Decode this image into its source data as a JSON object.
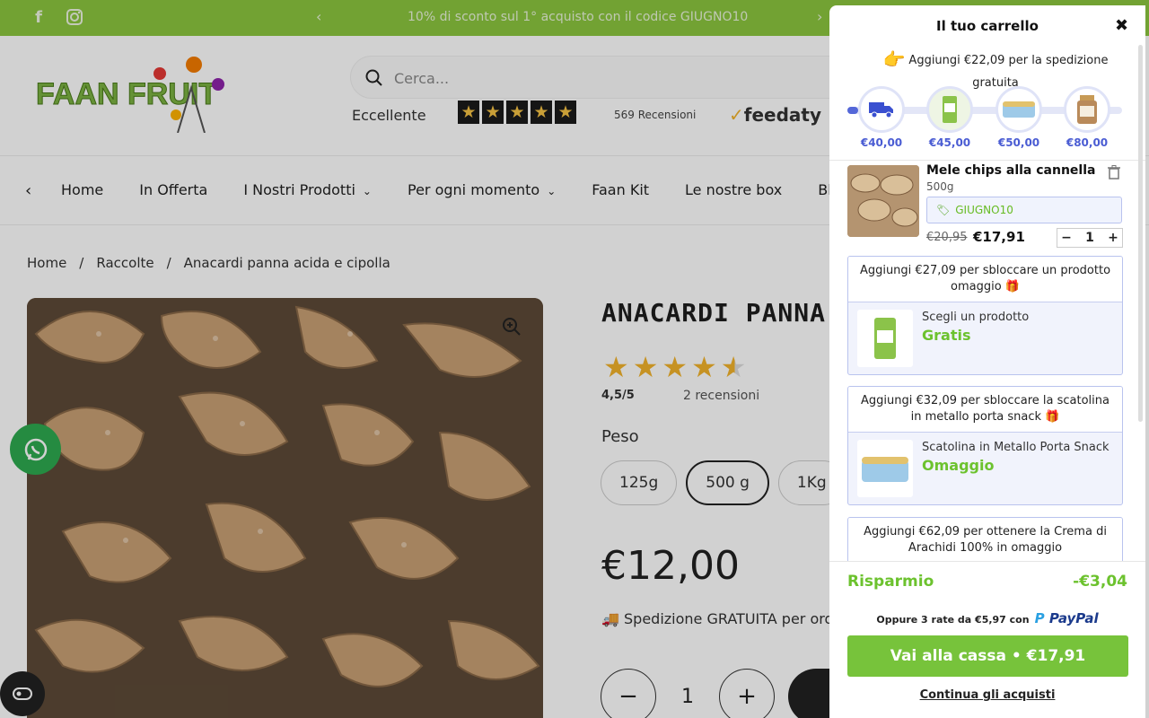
{
  "announcement": {
    "message": "10% di sconto sul 1° acquisto con il codice GIUGNO10",
    "prev": "‹",
    "next": "›",
    "social": [
      "facebook-icon",
      "instagram-icon"
    ]
  },
  "header": {
    "logo_text": "FAAN FRUIT",
    "search_placeholder": "Cerca...",
    "rating_label": "Eccellente",
    "reviews": "569 Recensioni",
    "review_brand": "feedaty"
  },
  "nav": {
    "items": [
      "Home",
      "In Offerta",
      "I Nostri Prodotti",
      "Per ogni momento",
      "Faan Kit",
      "Le nostre box",
      "Blog"
    ]
  },
  "breadcrumb": [
    "Home",
    "/",
    "Raccolte",
    "/",
    "Anacardi panna acida e cipolla"
  ],
  "product": {
    "title": "ANACARDI PANNA ACI",
    "rating": "4,5/5",
    "reviews": "2 recensioni",
    "weight_label": "Peso",
    "options": [
      "125g",
      "500 g",
      "1Kg"
    ],
    "selected_option": "500 g",
    "price": "€12,00",
    "shipping": "🚚 Spedizione GRATUITA per ord",
    "quantity": "1",
    "minus": "−",
    "plus": "+"
  },
  "cart": {
    "title": "Il tuo carrello",
    "close": "✖",
    "shipping_msg": "Aggiungi €22,09 per la spedizione gratuita",
    "progress_fraction": 0.04,
    "milestones": [
      {
        "amount": "€40,00",
        "icon": "truck-icon"
      },
      {
        "amount": "€45,00",
        "icon": "bag-icon"
      },
      {
        "amount": "€50,00",
        "icon": "tin-icon"
      },
      {
        "amount": "€80,00",
        "icon": "jar-icon"
      }
    ],
    "item": {
      "name": "Mele chips alla cannella",
      "weight": "500g",
      "coupon": "GIUGNO10",
      "old_price": "€20,95",
      "new_price": "€17,91",
      "qty": "1"
    },
    "offers": [
      {
        "head": "Aggiungi €27,09 per sbloccare un prodotto omaggio 🎁",
        "label": "Scegli un prodotto",
        "value": "Gratis"
      },
      {
        "head": "Aggiungi €32,09 per sbloccare la scatolina in metallo porta snack 🎁",
        "label": "Scatolina in Metallo Porta Snack",
        "value": "Omaggio"
      },
      {
        "head": "Aggiungi €62,09 per ottenere la Crema di Arachidi 100% in omaggio"
      }
    ],
    "savings_label": "Risparmio",
    "savings_value": "-€3,04",
    "installments": "Oppure 3 rate da €5,97 con",
    "paypal": "PayPal",
    "checkout": "Vai alla cassa • €17,91",
    "continue": "Continua gli acquisti"
  }
}
